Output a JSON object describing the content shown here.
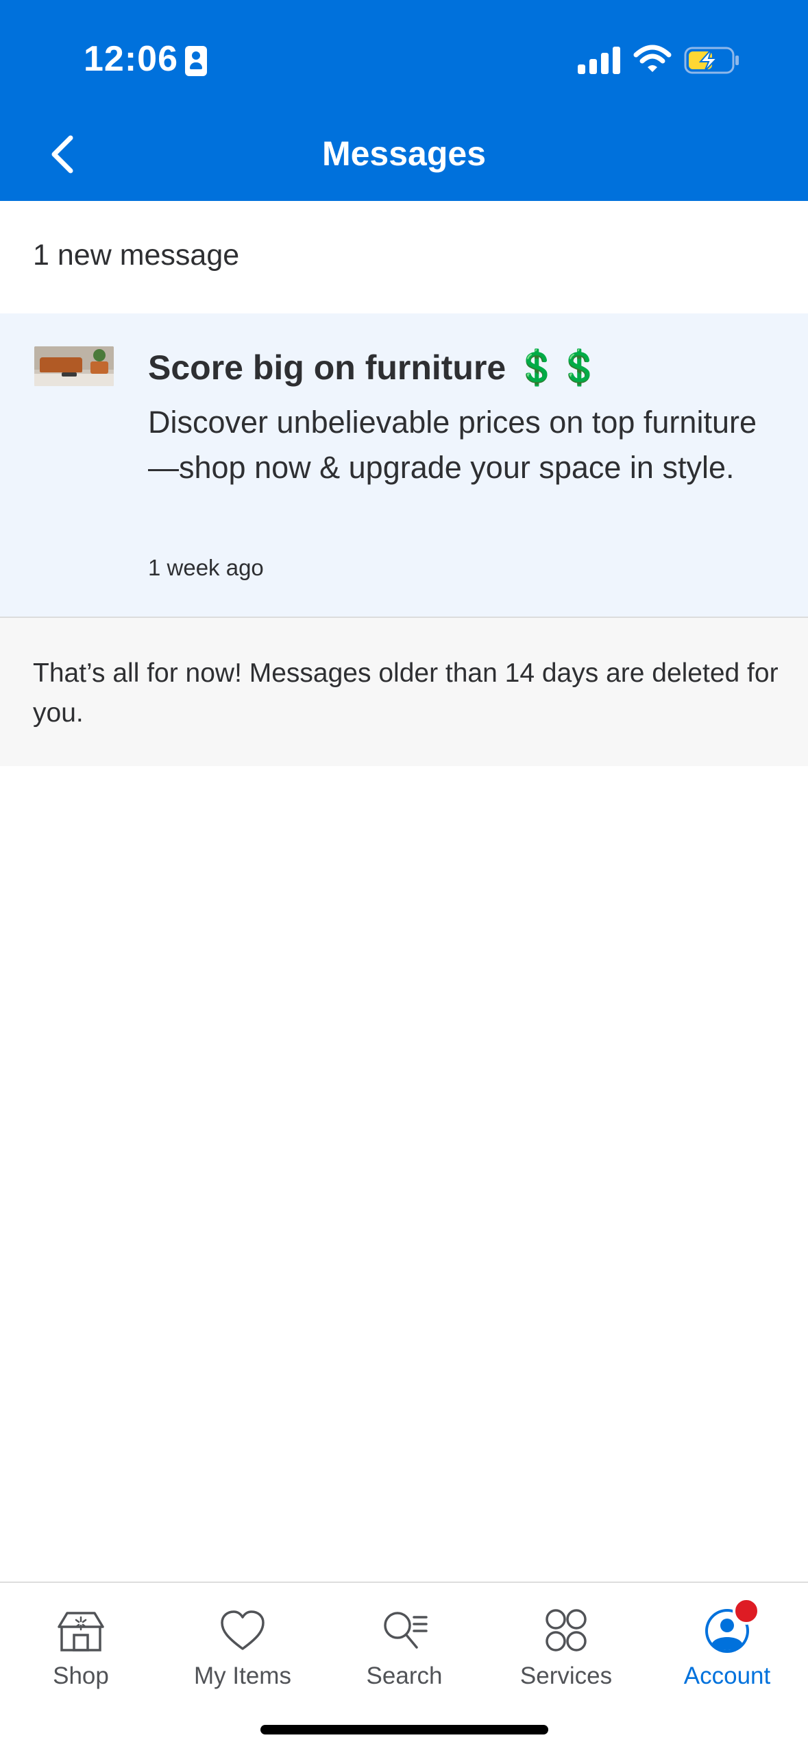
{
  "status_bar": {
    "time": "12:06"
  },
  "header": {
    "title": "Messages",
    "back_icon": "chevron-left-icon",
    "background_color": "#0071dc"
  },
  "summary": {
    "new_count_text": "1 new message"
  },
  "messages": [
    {
      "title": "Score big on furniture 💲💲",
      "body": "Discover unbelievable prices on top furniture—shop now & upgrade your space in style.",
      "time": "1 week ago",
      "unread": true
    }
  ],
  "footer_note": "That’s all for now! Messages older than 14 days are deleted for you.",
  "tabs": [
    {
      "label": "Shop",
      "icon": "store-icon",
      "active": false
    },
    {
      "label": "My Items",
      "icon": "heart-icon",
      "active": false
    },
    {
      "label": "Search",
      "icon": "search-list-icon",
      "active": false
    },
    {
      "label": "Services",
      "icon": "grid-circles-icon",
      "active": false
    },
    {
      "label": "Account",
      "icon": "account-icon",
      "active": true,
      "has_badge": true
    }
  ],
  "colors": {
    "accent": "#0071dc",
    "unread_background": "#eff5fd",
    "badge": "#de1c24"
  }
}
